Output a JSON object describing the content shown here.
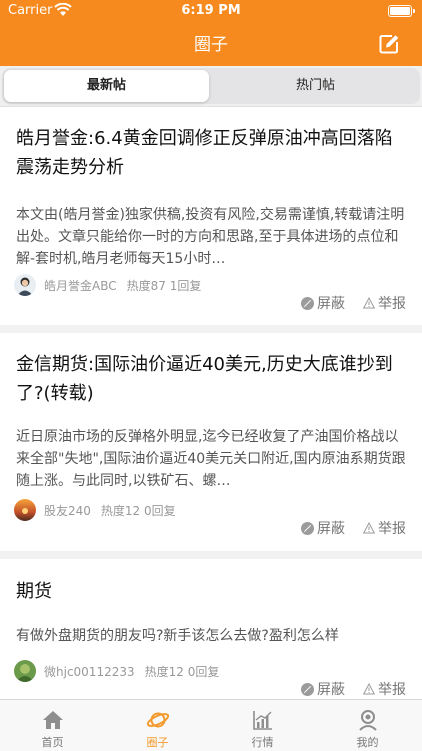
{
  "status_bar": {
    "carrier": "Carrier",
    "time": "6:19 PM"
  },
  "nav": {
    "title": "圈子",
    "compose_icon": "edit-icon"
  },
  "segments": [
    {
      "label": "最新帖",
      "active": true
    },
    {
      "label": "热门帖",
      "active": false
    }
  ],
  "posts": [
    {
      "title": "皓月誉金:6.4黄金回调修正反弹原油冲高回落陷震荡走势分析",
      "excerpt": "本文由(皓月誉金)独家供稿,投资有风险,交易需谨慎,转载请注明出处。文章只能给你一时的方向和思路,至于具体进场的点位和解-套时机,皓月老师每天15小时…",
      "author": "皓月誉金ABC",
      "stats": "热度87 1回复",
      "block_label": "屏蔽",
      "report_label": "举报"
    },
    {
      "title": "金信期货:国际油价逼近40美元,历史大底谁抄到了?(转载)",
      "excerpt": "近日原油市场的反弹格外明显,迄今已经收复了产油国价格战以来全部\"失地\",国际油价逼近40美元关口附近,国内原油系期货跟随上涨。与此同时,以铁矿石、螺…",
      "author": "股友240",
      "stats": "热度12 0回复",
      "block_label": "屏蔽",
      "report_label": "举报"
    },
    {
      "title": "期货",
      "excerpt": "有做外盘期货的朋友吗?新手该怎么去做?盈利怎么样",
      "author": "微hjc00112233",
      "stats": "热度12 0回复",
      "block_label": "屏蔽",
      "report_label": "举报"
    }
  ],
  "tabbar": [
    {
      "label": "首页",
      "icon": "home-icon",
      "active": false
    },
    {
      "label": "圈子",
      "icon": "planet-icon",
      "active": true
    },
    {
      "label": "行情",
      "icon": "chart-icon",
      "active": false
    },
    {
      "label": "我的",
      "icon": "profile-icon",
      "active": false
    }
  ],
  "colors": {
    "brand": "#f68a1e",
    "tab_active": "#f39a2e"
  }
}
